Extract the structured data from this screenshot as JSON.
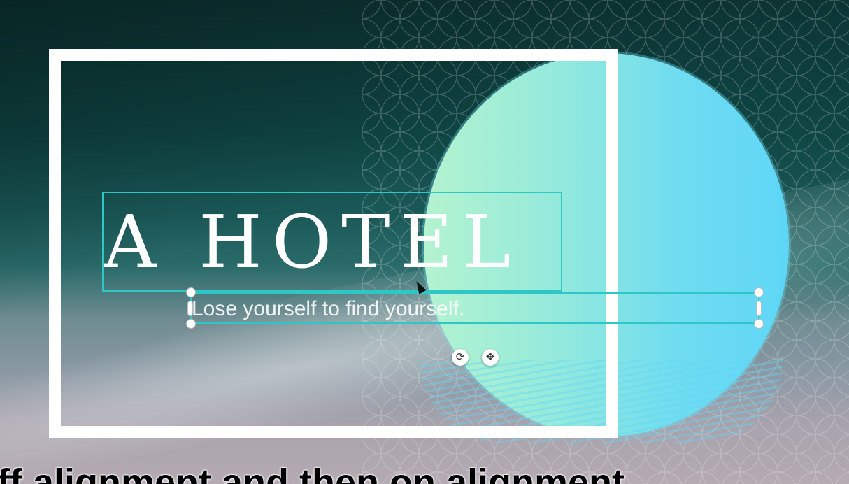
{
  "design": {
    "title": "A HOTEL",
    "tagline": "Lose yourself to find yourself.",
    "accent_selection_color": "#2ec6c6",
    "circle_gradient": [
      "#b4f3cf",
      "#5fd6f7"
    ],
    "frame_color": "#ffffff"
  },
  "toolbar": {
    "rotate_icon": "rotate-icon",
    "move_icon": "move-icon",
    "rotate_glyph": "⟳",
    "move_glyph": "✥"
  },
  "caption": {
    "text": "ff alignment and then on alignment"
  }
}
